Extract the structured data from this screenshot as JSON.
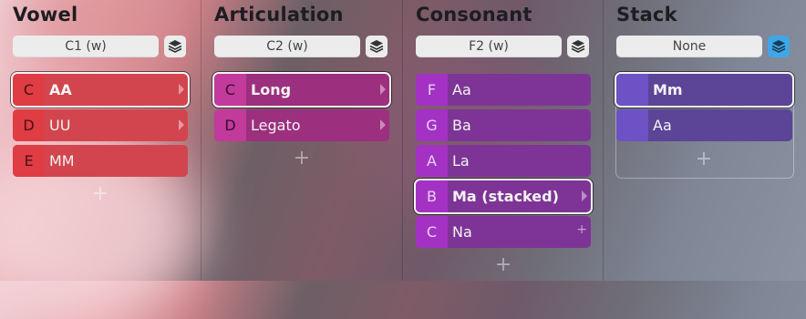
{
  "columns": [
    {
      "title": "Vowel",
      "selector": "C1 (w)",
      "items": [
        {
          "note": "C",
          "label": "AA",
          "selected": true,
          "trailing": "chevron"
        },
        {
          "note": "D",
          "label": "UU",
          "selected": false,
          "trailing": "chevron"
        },
        {
          "note": "E",
          "label": "MM",
          "selected": false,
          "trailing": ""
        }
      ]
    },
    {
      "title": "Articulation",
      "selector": "C2 (w)",
      "items": [
        {
          "note": "C",
          "label": "Long",
          "selected": true,
          "trailing": "chevron"
        },
        {
          "note": "D",
          "label": "Legato",
          "selected": false,
          "trailing": "chevron"
        }
      ]
    },
    {
      "title": "Consonant",
      "selector": "F2 (w)",
      "items": [
        {
          "note": "F",
          "label": "Aa",
          "selected": false,
          "trailing": ""
        },
        {
          "note": "G",
          "label": "Ba",
          "selected": false,
          "trailing": ""
        },
        {
          "note": "A",
          "label": "La",
          "selected": false,
          "trailing": ""
        },
        {
          "note": "B",
          "label": "Ma (stacked)",
          "selected": true,
          "trailing": "chevron"
        },
        {
          "note": "C",
          "label": "Na",
          "selected": false,
          "trailing": "plus"
        }
      ]
    },
    {
      "title": "Stack",
      "selector": "None",
      "items": [
        {
          "note": "",
          "label": "Mm",
          "selected": true,
          "trailing": ""
        },
        {
          "note": "",
          "label": "Aa",
          "selected": false,
          "trailing": ""
        }
      ]
    }
  ],
  "icons": {
    "stack": "layers-icon",
    "add": "plus-icon",
    "expand": "chevron-right-icon"
  },
  "colors": {
    "vowel_row": "#d2454e",
    "vowel_note": "#e03c43",
    "articulation_row": "#9c2f7e",
    "articulation_note": "#c23a9c",
    "consonant_row": "#7e3496",
    "consonant_note": "#a332c4",
    "stack_row": "#5c4496",
    "stack_note": "#6c52c4",
    "stack_toggle_on": "#3fa7e6"
  }
}
